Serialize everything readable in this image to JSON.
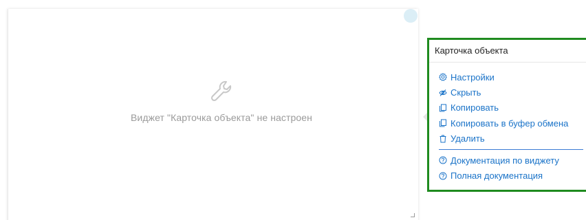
{
  "widget": {
    "placeholder_text": "Виджет \"Карточка объекта\" не настроен",
    "placeholder_icon": "wrench-icon"
  },
  "menu": {
    "title": "Карточка объекта",
    "items": [
      {
        "label": "Настройки",
        "icon": "gear-icon"
      },
      {
        "label": "Скрыть",
        "icon": "eye-off-icon"
      },
      {
        "label": "Копировать",
        "icon": "copy-icon"
      },
      {
        "label": "Копировать в буфер обмена",
        "icon": "copy-icon"
      },
      {
        "label": "Удалить",
        "icon": "trash-icon"
      }
    ],
    "help_items": [
      {
        "label": "Документация по виджету",
        "icon": "help-circle-icon"
      },
      {
        "label": "Полная документация",
        "icon": "help-circle-icon"
      }
    ]
  },
  "colors": {
    "link": "#1a73c8",
    "menu_border": "#1f8b1f",
    "placeholder": "#9a9a9a"
  }
}
